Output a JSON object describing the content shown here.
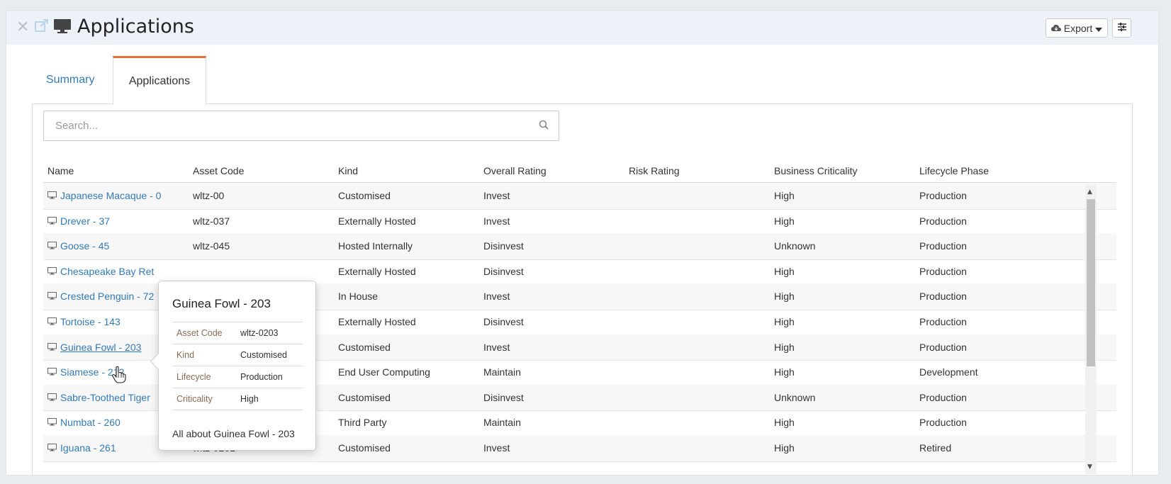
{
  "header": {
    "title": "Applications",
    "export_label": "Export",
    "icons": [
      "close-icon",
      "share-icon",
      "desktop-icon",
      "cloud-download-icon",
      "caret-down-icon",
      "filter-icon"
    ]
  },
  "tabs": [
    {
      "label": "Summary",
      "active": false
    },
    {
      "label": "Applications",
      "active": true
    }
  ],
  "search": {
    "placeholder": "Search..."
  },
  "table": {
    "columns": [
      "Name",
      "Asset Code",
      "Kind",
      "Overall Rating",
      "Risk Rating",
      "Business Criticality",
      "Lifecycle Phase"
    ],
    "rows": [
      {
        "name": "Japanese Macaque - 0",
        "asset_code": "wltz-00",
        "kind": "Customised",
        "overall": "Invest",
        "risk": "",
        "criticality": "High",
        "lifecycle": "Production"
      },
      {
        "name": "Drever - 37",
        "asset_code": "wltz-037",
        "kind": "Externally Hosted",
        "overall": "Invest",
        "risk": "",
        "criticality": "High",
        "lifecycle": "Production"
      },
      {
        "name": "Goose - 45",
        "asset_code": "wltz-045",
        "kind": "Hosted Internally",
        "overall": "Disinvest",
        "risk": "",
        "criticality": "Unknown",
        "lifecycle": "Production"
      },
      {
        "name": "Chesapeake Bay Ret",
        "asset_code": "",
        "kind": "Externally Hosted",
        "overall": "Disinvest",
        "risk": "",
        "criticality": "High",
        "lifecycle": "Production"
      },
      {
        "name": "Crested Penguin - 72",
        "asset_code": "",
        "kind": "In House",
        "overall": "Invest",
        "risk": "",
        "criticality": "High",
        "lifecycle": "Production"
      },
      {
        "name": "Tortoise - 143",
        "asset_code": "",
        "kind": "Externally Hosted",
        "overall": "Disinvest",
        "risk": "",
        "criticality": "High",
        "lifecycle": "Production"
      },
      {
        "name": "Guinea Fowl - 203",
        "asset_code": "",
        "kind": "Customised",
        "overall": "Invest",
        "risk": "",
        "criticality": "High",
        "lifecycle": "Production"
      },
      {
        "name": "Siamese - 212",
        "asset_code": "",
        "kind": "End User Computing",
        "overall": "Maintain",
        "risk": "",
        "criticality": "High",
        "lifecycle": "Development"
      },
      {
        "name": "Sabre-Toothed Tiger",
        "asset_code": "",
        "kind": "Customised",
        "overall": "Disinvest",
        "risk": "",
        "criticality": "Unknown",
        "lifecycle": "Production"
      },
      {
        "name": "Numbat - 260",
        "asset_code": "",
        "kind": "Third Party",
        "overall": "Maintain",
        "risk": "",
        "criticality": "High",
        "lifecycle": "Production"
      },
      {
        "name": "Iguana - 261",
        "asset_code": "wltz-0261",
        "kind": "Customised",
        "overall": "Invest",
        "risk": "",
        "criticality": "High",
        "lifecycle": "Retired"
      }
    ]
  },
  "popover": {
    "title": "Guinea Fowl - 203",
    "fields": [
      {
        "key": "Asset Code",
        "value": "wltz-0203"
      },
      {
        "key": "Kind",
        "value": "Customised"
      },
      {
        "key": "Lifecycle",
        "value": "Production"
      },
      {
        "key": "Criticality",
        "value": "High"
      }
    ],
    "footer": "All about Guinea Fowl - 203"
  },
  "colors": {
    "link": "#337ab7",
    "active_tab_accent": "#e8703a",
    "header_bg": "#edf2f9"
  }
}
